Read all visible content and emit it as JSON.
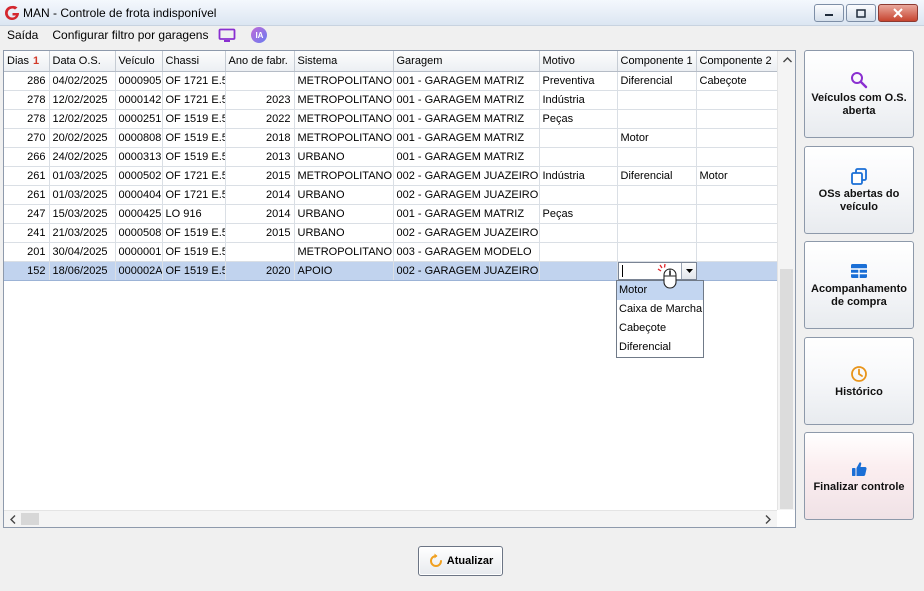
{
  "window": {
    "title": "MAN - Controle de frota indisponível"
  },
  "menu": {
    "exit": "Saída",
    "config_filter": "Configurar filtro por garagens",
    "ia_badge": "IA"
  },
  "grid": {
    "columns": [
      "Dias",
      "Data O.S.",
      "Veículo",
      "Chassi",
      "Ano de fabr.",
      "Sistema",
      "Garagem",
      "Motivo",
      "Componente 1",
      "Componente 2"
    ],
    "sort_column": "Dias",
    "sort_indicator": "1",
    "rows": [
      {
        "dias": "286",
        "data": "04/02/2025",
        "veiculo": "0000905",
        "chassi": "OF 1721 E.5",
        "ano": "",
        "sistema": "METROPOLITANO",
        "garagem": "001 - GARAGEM MATRIZ",
        "motivo": "Preventiva",
        "comp1": "Diferencial",
        "comp2": "Cabeçote"
      },
      {
        "dias": "278",
        "data": "12/02/2025",
        "veiculo": "0000142",
        "chassi": "OF 1721 E.5",
        "ano": "2023",
        "sistema": "METROPOLITANO",
        "garagem": "001 - GARAGEM MATRIZ",
        "motivo": "Indústria",
        "comp1": "",
        "comp2": ""
      },
      {
        "dias": "278",
        "data": "12/02/2025",
        "veiculo": "0000251",
        "chassi": "OF 1519 E.5",
        "ano": "2022",
        "sistema": "METROPOLITANO",
        "garagem": "001 - GARAGEM MATRIZ",
        "motivo": "Peças",
        "comp1": "",
        "comp2": ""
      },
      {
        "dias": "270",
        "data": "20/02/2025",
        "veiculo": "0000808",
        "chassi": "OF 1519 E.5",
        "ano": "2018",
        "sistema": "METROPOLITANO",
        "garagem": "001 - GARAGEM MATRIZ",
        "motivo": "",
        "comp1": "Motor",
        "comp2": ""
      },
      {
        "dias": "266",
        "data": "24/02/2025",
        "veiculo": "0000313",
        "chassi": "OF 1519 E.5",
        "ano": "2013",
        "sistema": "URBANO",
        "garagem": "001 - GARAGEM MATRIZ",
        "motivo": "",
        "comp1": "",
        "comp2": ""
      },
      {
        "dias": "261",
        "data": "01/03/2025",
        "veiculo": "0000502",
        "chassi": "OF 1721 E.5",
        "ano": "2015",
        "sistema": "METROPOLITANO",
        "garagem": "002 - GARAGEM JUAZEIRO",
        "motivo": "Indústria",
        "comp1": "Diferencial",
        "comp2": "Motor"
      },
      {
        "dias": "261",
        "data": "01/03/2025",
        "veiculo": "0000404",
        "chassi": "OF 1721 E.5",
        "ano": "2014",
        "sistema": "URBANO",
        "garagem": "002 - GARAGEM JUAZEIRO",
        "motivo": "",
        "comp1": "",
        "comp2": ""
      },
      {
        "dias": "247",
        "data": "15/03/2025",
        "veiculo": "0000425",
        "chassi": "LO 916",
        "ano": "2014",
        "sistema": "URBANO",
        "garagem": "001 - GARAGEM MATRIZ",
        "motivo": "Peças",
        "comp1": "",
        "comp2": ""
      },
      {
        "dias": "241",
        "data": "21/03/2025",
        "veiculo": "0000508",
        "chassi": "OF 1519 E.5",
        "ano": "2015",
        "sistema": "URBANO",
        "garagem": "002 - GARAGEM JUAZEIRO",
        "motivo": "",
        "comp1": "",
        "comp2": ""
      },
      {
        "dias": "201",
        "data": "30/04/2025",
        "veiculo": "0000001",
        "chassi": "OF 1519 E.5",
        "ano": "",
        "sistema": "METROPOLITANO",
        "garagem": "003 - GARAGEM MODELO",
        "motivo": "",
        "comp1": "",
        "comp2": ""
      },
      {
        "dias": "152",
        "data": "18/06/2025",
        "veiculo": "000002A",
        "chassi": "OF 1519 E.5",
        "ano": "2020",
        "sistema": "APOIO",
        "garagem": "002 - GARAGEM JUAZEIRO",
        "motivo": "",
        "comp1": "",
        "comp2": ""
      }
    ],
    "selected_row": 10
  },
  "dropdown": {
    "options": [
      "Motor",
      "Caixa de Marcha",
      "Cabeçote",
      "Diferencial"
    ],
    "highlighted": "Motor"
  },
  "side_buttons": [
    {
      "label": "Veículos com O.S. aberta",
      "icon": "search-icon",
      "color": "#8a2fd0"
    },
    {
      "label": "OSs abertas do veículo",
      "icon": "copy-icon",
      "color": "#1a6fd6"
    },
    {
      "label": "Acompanhamento de compra",
      "icon": "table-icon",
      "color": "#1a6fd6"
    },
    {
      "label": "Histórico",
      "icon": "clock-icon",
      "color": "#e8941a"
    },
    {
      "label": "Finalizar controle",
      "icon": "thumbs-up-icon",
      "color": "#1a6fd6"
    }
  ],
  "footer": {
    "refresh_label": "Atualizar"
  },
  "colors": {
    "accent": "#d23a2a",
    "selection": "#c1d3ee",
    "monitor_icon": "#8a2fd0"
  }
}
